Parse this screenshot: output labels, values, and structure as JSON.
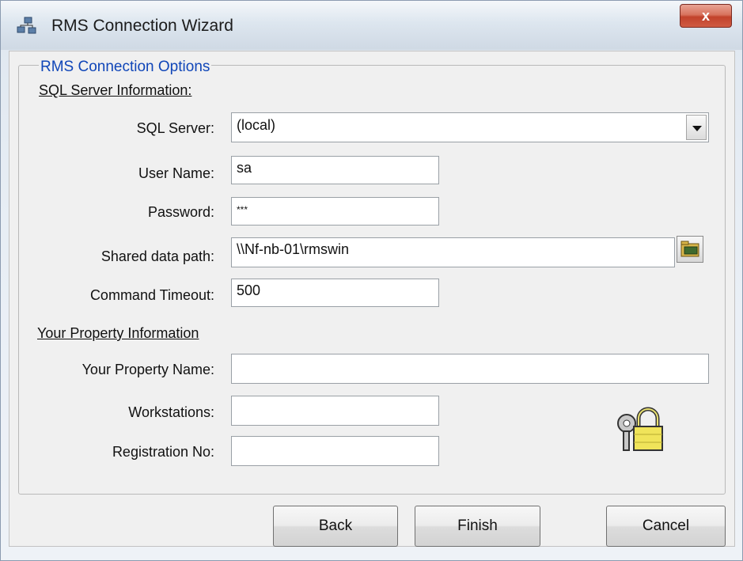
{
  "window": {
    "title": "RMS Connection Wizard",
    "close_label": "x"
  },
  "group": {
    "legend": "RMS Connection Options"
  },
  "sql_section": {
    "heading": "SQL Server Information:",
    "sql_server_label": "SQL Server:",
    "sql_server_value": "(local)",
    "user_name_label": "User Name:",
    "user_name_value": "sa",
    "password_label": "Password:",
    "password_value": "***",
    "shared_path_label": "Shared data path:",
    "shared_path_value": "\\\\Nf-nb-01\\rmswin",
    "timeout_label": "Command Timeout:",
    "timeout_value": "500"
  },
  "property_section": {
    "heading": "Your Property Information",
    "property_name_label": "Your Property Name:",
    "property_name_value": "",
    "workstations_label": "Workstations:",
    "workstations_value": "",
    "registration_label": "Registration No:",
    "registration_value": ""
  },
  "buttons": {
    "back": "Back",
    "finish": "Finish",
    "cancel": "Cancel"
  },
  "icons": {
    "title": "network-computers-icon",
    "browse": "folder-browse-icon",
    "lock": "keys-padlock-icon"
  }
}
